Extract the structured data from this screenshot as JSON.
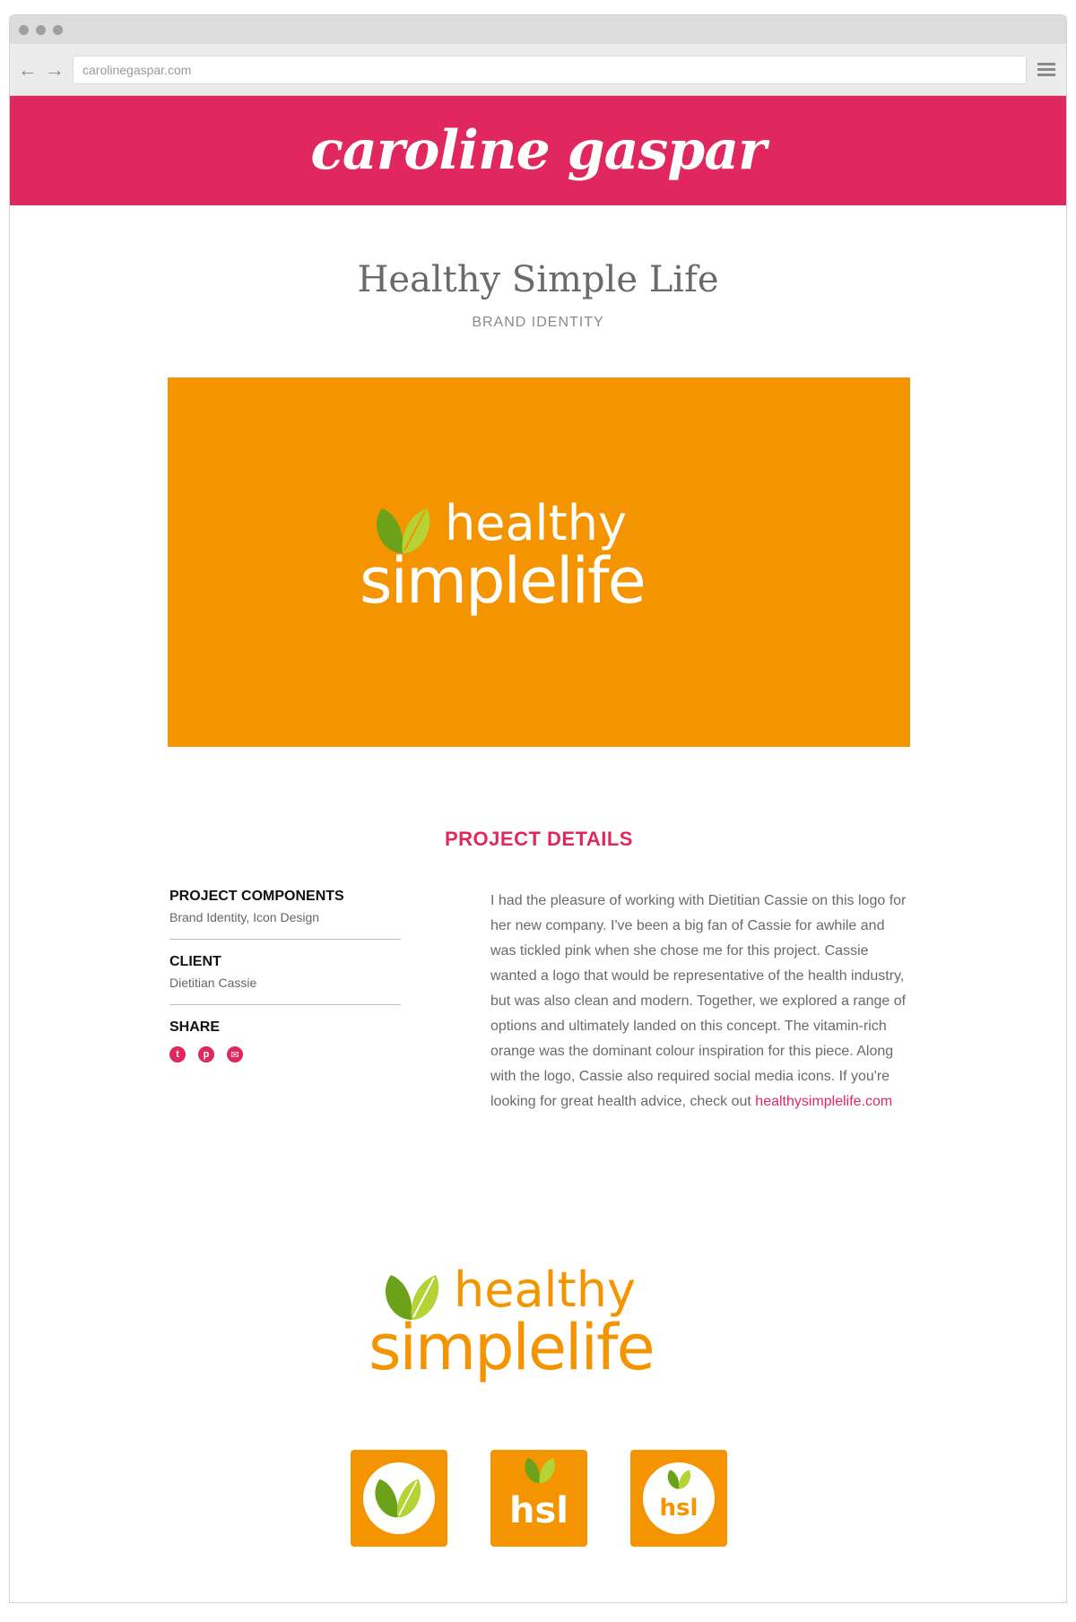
{
  "browser": {
    "url": "carolinegaspar.com"
  },
  "site": {
    "logo": "caroline gaspar"
  },
  "project": {
    "title": "Healthy Simple Life",
    "category": "BRAND IDENTITY"
  },
  "brand": {
    "line1": "healthy",
    "line2": "simplelife",
    "monogram": "hsl"
  },
  "details": {
    "heading": "PROJECT DETAILS",
    "components_label": "PROJECT COMPONENTS",
    "components_value": "Brand Identity, Icon Design",
    "client_label": "CLIENT",
    "client_value": "Dietitian Cassie",
    "share_label": "SHARE",
    "share_icons": [
      "twitter-icon",
      "pinterest-icon",
      "email-icon"
    ],
    "description": "I had the pleasure of working with Dietitian Cassie on this logo for her new company. I've been a big fan of Cassie for awhile and was tickled pink when she chose me for this project. Cassie wanted a logo that would be representative of the health industry, but was also clean and modern. Together, we explored a range of options and ultimately landed on this concept. The vitamin-rich orange was the dominant colour inspiration for this piece. Along with the logo, Cassie also required social media icons. If you're looking for great health advice, check out",
    "link": "healthysimplelife.com"
  },
  "colors": {
    "brand_pink": "#e0285f",
    "brand_orange": "#f39400",
    "leaf_green": "#6ba21a",
    "leaf_lime": "#b5d334"
  }
}
